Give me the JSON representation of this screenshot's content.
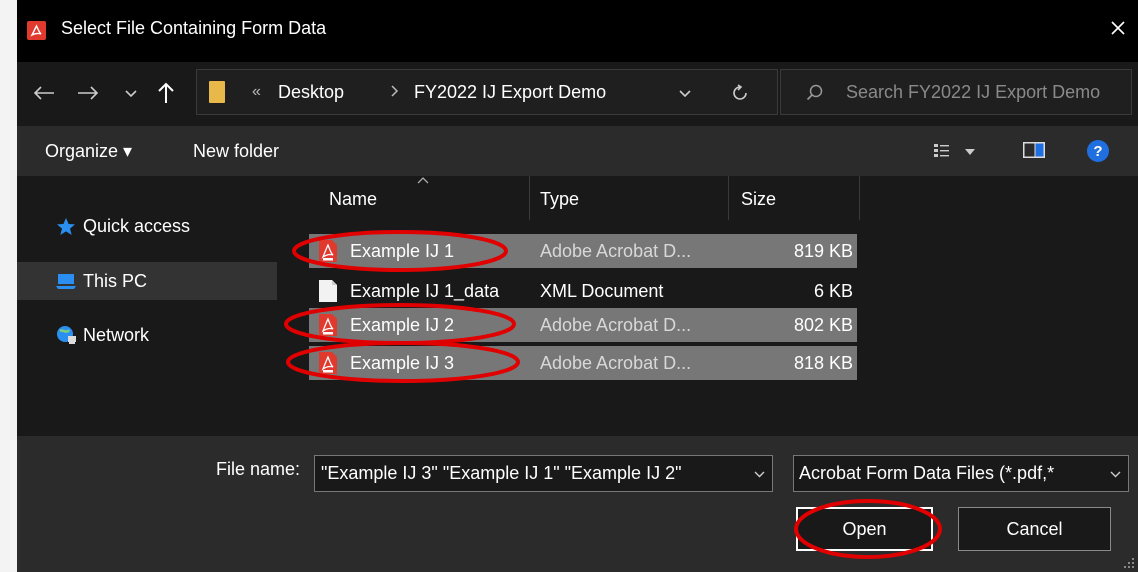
{
  "window": {
    "title": "Select File Containing Form Data"
  },
  "nav": {
    "breadcrumb_overflow": "«",
    "breadcrumbs": [
      "Desktop",
      "FY2022 IJ Export Demo"
    ],
    "search_placeholder": "Search FY2022 IJ Export Demo"
  },
  "toolbar": {
    "organize_label": "Organize ▾",
    "new_folder_label": "New folder"
  },
  "sidebar": {
    "items": [
      {
        "label": "Quick access",
        "icon": "star-icon"
      },
      {
        "label": "This PC",
        "icon": "computer-icon"
      },
      {
        "label": "Network",
        "icon": "network-icon"
      }
    ],
    "selected": "This PC"
  },
  "file_list": {
    "columns": [
      "Name",
      "Type",
      "Size"
    ],
    "rows": [
      {
        "name": "Example IJ 1",
        "type": "Adobe Acrobat D...",
        "size": "819 KB",
        "icon": "pdf-icon",
        "selected": true
      },
      {
        "name": "Example IJ 1_data",
        "type": "XML Document",
        "size": "6 KB",
        "icon": "document-icon",
        "selected": false
      },
      {
        "name": "Example IJ 2",
        "type": "Adobe Acrobat D...",
        "size": "802 KB",
        "icon": "pdf-icon",
        "selected": true
      },
      {
        "name": "Example IJ 3",
        "type": "Adobe Acrobat D...",
        "size": "818 KB",
        "icon": "pdf-icon",
        "selected": true
      }
    ]
  },
  "bottom": {
    "file_name_label": "File name:",
    "file_name_value": "\"Example IJ 3\" \"Example IJ 1\" \"Example IJ 2\"",
    "file_type_value": "Acrobat Form Data Files (*.pdf,*",
    "open_label": "Open",
    "cancel_label": "Cancel"
  },
  "colors": {
    "annotation": "#e00000",
    "selection": "#777777",
    "help_blue": "#1f6fe0",
    "pdf_red": "#e03a2f"
  }
}
